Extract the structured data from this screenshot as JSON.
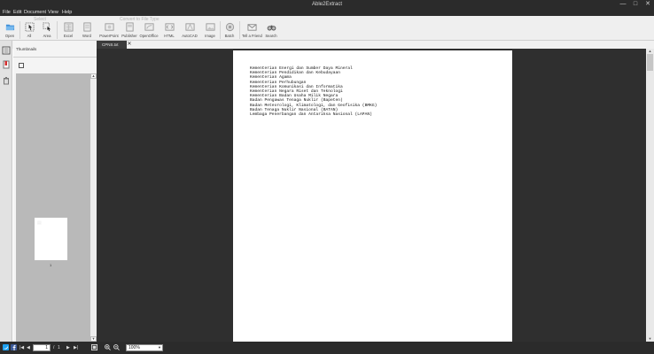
{
  "window": {
    "title": "Able2Extract",
    "controls": [
      "—",
      "□",
      "✕"
    ]
  },
  "menu": [
    "File",
    "Edit",
    "Document",
    "View",
    "Help"
  ],
  "toolbar": {
    "groups": {
      "select": "Select",
      "convert": "Convert to File Type"
    },
    "buttons": {
      "open": "Open",
      "all": "All",
      "area": "Area",
      "excel": "Excel",
      "word": "Word",
      "powerpoint": "PowerPoint",
      "publisher": "Publisher",
      "openoffice": "OpenOffice",
      "html": "HTML",
      "autocad": "AutoCAD",
      "image": "Image",
      "batch": "Batch",
      "tell": "Tell a Friend",
      "search": "Search"
    },
    "icons": {
      "open": "folder-open-icon",
      "all": "select-all-cursor-icon",
      "area": "select-area-cursor-icon",
      "excel": "excel-icon",
      "word": "word-icon",
      "powerpoint": "powerpoint-icon",
      "publisher": "publisher-icon",
      "openoffice": "openoffice-icon",
      "html": "html-icon",
      "autocad": "autocad-icon",
      "image": "image-icon",
      "batch": "batch-icon",
      "tell": "envelope-icon",
      "search": "binoculars-icon"
    }
  },
  "tabs": {
    "active": "CPNS.txt",
    "close": "✕"
  },
  "thumbnails": {
    "title": "Thumbnails",
    "page_number": "1"
  },
  "document": {
    "lines": [
      "Kementerian Energi dan Sumber Daya Mineral",
      "Kementerian Pendidikan dan Kebudayaan",
      "Kementerian Agama",
      "Kementerian Perhubungan",
      "Kementerian Komunikasi dan Informatika",
      "Kementerian Negara Riset dan Teknologi",
      "Kementerian Badan Usaha Milik Negara",
      "Badan Pengawas Tenaga Nuklir (Bapeten)",
      "Badan Meteorologi, Klimatologi, dan Geofisika (BMKG)",
      "Badan Tenaga Nuklir Nasional (BATAN)",
      "Lembaga Penerbangan dan Antariksa Nasional (LAPAN)"
    ]
  },
  "statusbar": {
    "current_page": "1",
    "page_separator": "/",
    "total_pages": "1",
    "zoom": "100%"
  },
  "colors": {
    "chrome_dark": "#2b2b2b",
    "toolbar_bg": "#efefef",
    "doc_bg": "#2f2f2f",
    "twitter": "#1da1f2",
    "facebook": "#3b5998"
  }
}
